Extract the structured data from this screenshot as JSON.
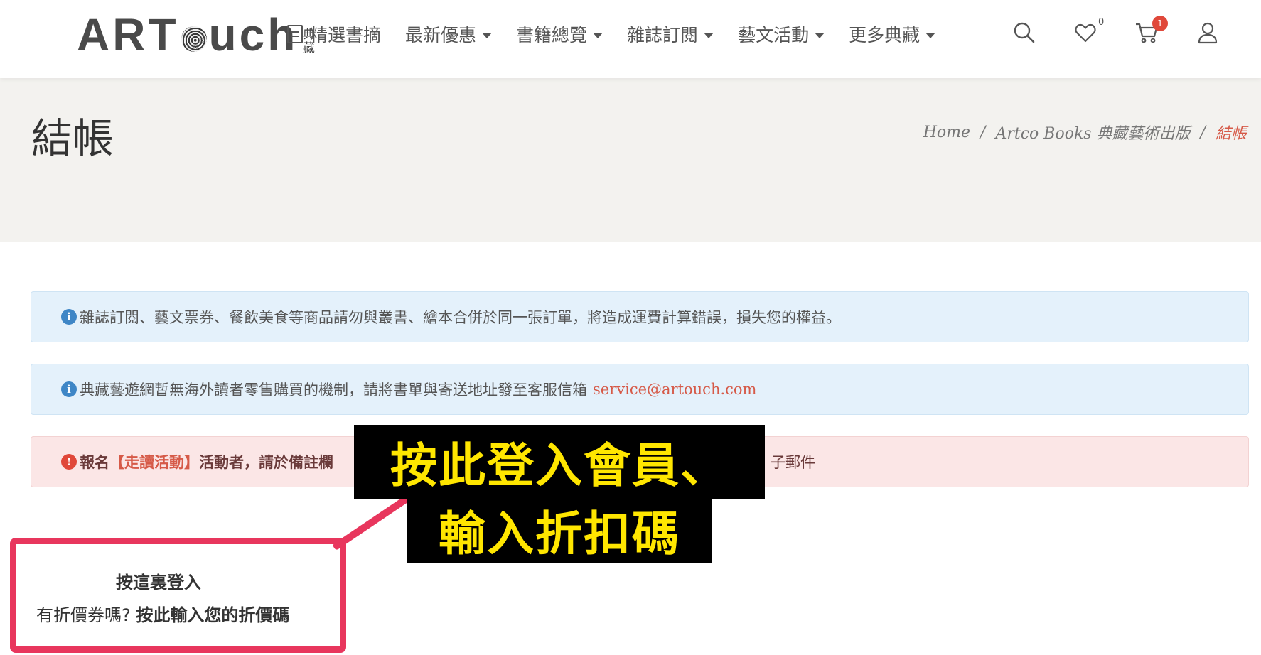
{
  "header": {
    "logo_text": "ARTouch",
    "logo_seal": "典藏",
    "nav": [
      {
        "label": "精選書摘",
        "has_dropdown": false,
        "icon": "book-icon"
      },
      {
        "label": "最新優惠",
        "has_dropdown": true
      },
      {
        "label": "書籍總覽",
        "has_dropdown": true
      },
      {
        "label": "雜誌訂閱",
        "has_dropdown": true
      },
      {
        "label": "藝文活動",
        "has_dropdown": true
      },
      {
        "label": "更多典藏",
        "has_dropdown": true
      }
    ],
    "icons": {
      "search": "search-icon",
      "wishlist": "heart-icon",
      "wishlist_count": "0",
      "cart": "cart-icon",
      "cart_count": "1",
      "account": "user-icon"
    }
  },
  "page": {
    "title": "結帳",
    "breadcrumb": {
      "home": "Home",
      "sep": "/",
      "publisher": "Artco Books 典藏藝術出版",
      "current": "結帳"
    }
  },
  "notices": {
    "n1_text": "雜誌訂閱、藝文票券、餐飲美食等商品請勿與叢書、繪本合併於同一張訂單，將造成運費計算錯誤，損失您的權益。",
    "n2_text": "典藏藝遊網暫無海外讀者零售購買的機制，請將書單與寄送地址發至客服信箱",
    "n2_email": "service@artouch.com",
    "n3_prefix": "報名",
    "n3_highlight": "【走讀活動】",
    "n3_mid": "活動者，請於",
    "n3_bold": "備註欄",
    "n3_suffix": "子郵件"
  },
  "login": {
    "title": "按這裏登入",
    "coupon_question": "有折價券嗎?",
    "coupon_link": "按此輸入您的折價碼"
  },
  "annotation": {
    "line1": "按此登入會員、",
    "line2": "輸入折扣碼"
  },
  "colors": {
    "accent": "#d65a48",
    "info_bg": "#e4f1fb",
    "danger_bg": "#fbe6e6",
    "highlight_border": "#e8365d",
    "callout_bg": "#000000",
    "callout_text": "#ffe600"
  }
}
